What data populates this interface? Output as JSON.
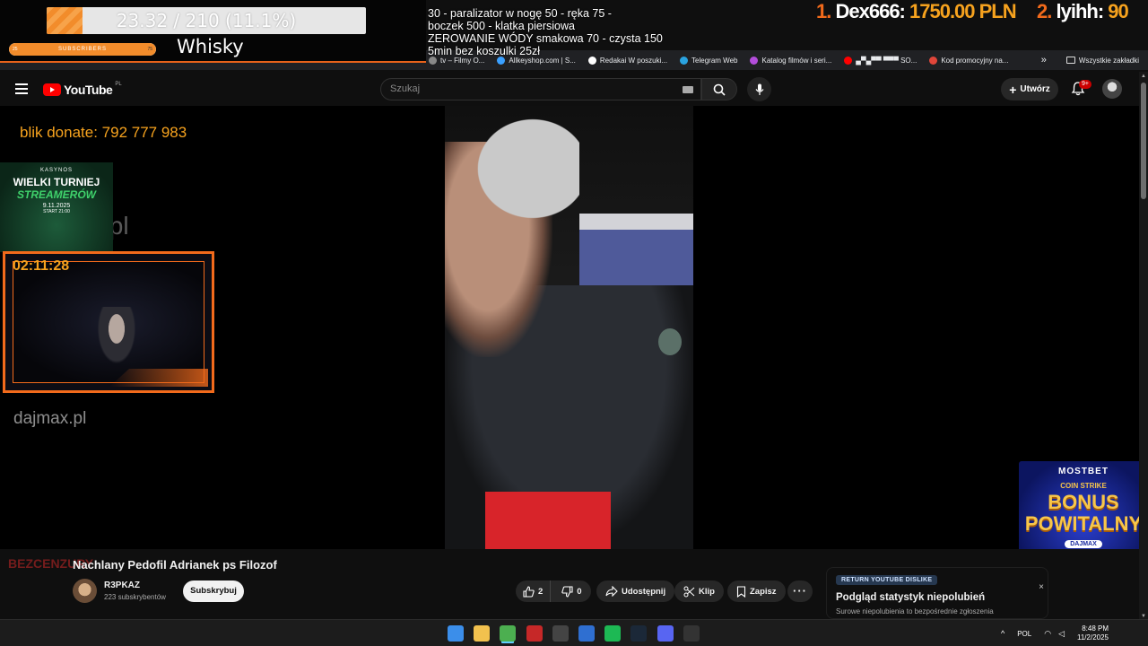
{
  "overlay": {
    "goal_text": "23.32 / 210 (11.1%)",
    "goal_fraction": 0.111,
    "subs_label": "SUBSCRIBERS",
    "subs_min": "25",
    "subs_max": "75",
    "drink": "Whisky",
    "price_lines": [
      "30 - paralizator w nogę 50 - ręka 75 -",
      " boczek 500 - klatka piersiowa",
      "ZEROWANIE WÓDY smakowa 70 - czysta 150",
      "5min bez koszulki 25zł"
    ],
    "leader_1": {
      "rank": "1.",
      "name": "Dex666:",
      "amount": "1750.00 PLN"
    },
    "leader_2": {
      "rank": "2.",
      "name": "lyihh:",
      "amount": "90"
    },
    "blik": "blik donate: 792 777 983",
    "promo": {
      "brand": "KASYNOS",
      "line1": "WIELKI TURNIEJ",
      "line2": "STREAMERÓW",
      "date": "9.11.2025",
      "start": "START 21:00"
    },
    "watermark_1": "x.pl",
    "watermark_2": "dajmax.pl",
    "cam_timer": "02:11:28",
    "bezcenzury": "BEZCENZURY",
    "ad": {
      "brand": "MOSTBET",
      "coin": "COIN STRIKE",
      "bonus_1": "BONUS",
      "bonus_2": "POWITALNY",
      "tag": "DAJMAX"
    }
  },
  "bookmarks": [
    {
      "label": "tv – Filmy O...",
      "color": "#888888"
    },
    {
      "label": "Allkeyshop.com | S...",
      "color": "#3aa0ff"
    },
    {
      "label": "Redakai W poszuki...",
      "color": "#ffffff"
    },
    {
      "label": "Telegram Web",
      "color": "#2aa3e0"
    },
    {
      "label": "Katalog filmów i seri...",
      "color": "#b34ddb"
    },
    {
      "label": "▄▀▄▀▀ ▀▀▀ SO...",
      "color": "#ff0000"
    },
    {
      "label": "Kod promocyjny na...",
      "color": "#e0463a"
    }
  ],
  "bookmarks_more": "»",
  "bookmarks_all": "Wszystkie zakładki",
  "youtube": {
    "brand": "YouTube",
    "country": "PL",
    "search_placeholder": "Szukaj",
    "create_label": "Utwórz",
    "notif_badge": "9+"
  },
  "video": {
    "title": "Nachlany Pedofil Adrianek ps Filozof",
    "channel": "R3PKAZ",
    "subscribers": "223 subskrybentów",
    "subscribe_label": "Subskrybuj",
    "likes": "2",
    "dislikes": "0",
    "share_label": "Udostępnij",
    "clip_label": "Klip",
    "save_label": "Zapisz"
  },
  "ryd": {
    "tag": "RETURN YOUTUBE DISLIKE",
    "title": "Podgląd statystyk niepolubień",
    "desc": "Surowe niepolubienia to bezpośrednie zgłoszenia",
    "close": "×"
  },
  "taskbar": {
    "lang": "POL",
    "time": "8:48 PM",
    "date": "11/2/2025",
    "icons": [
      {
        "name": "windows-start-icon",
        "color": "#3b8eea"
      },
      {
        "name": "file-explorer-icon",
        "color": "#f2c14e"
      },
      {
        "name": "chrome-icon",
        "color": "#4caf50"
      },
      {
        "name": "voicemeeter-icon",
        "color": "#c62828"
      },
      {
        "name": "obs-icon",
        "color": "#444444"
      },
      {
        "name": "app-c-icon",
        "color": "#2f6fd1"
      },
      {
        "name": "spotify-icon",
        "color": "#1db954"
      },
      {
        "name": "steam-icon",
        "color": "#1b2838"
      },
      {
        "name": "discord-icon",
        "color": "#5865f2"
      },
      {
        "name": "app-arrow-icon",
        "color": "#333333"
      }
    ]
  }
}
